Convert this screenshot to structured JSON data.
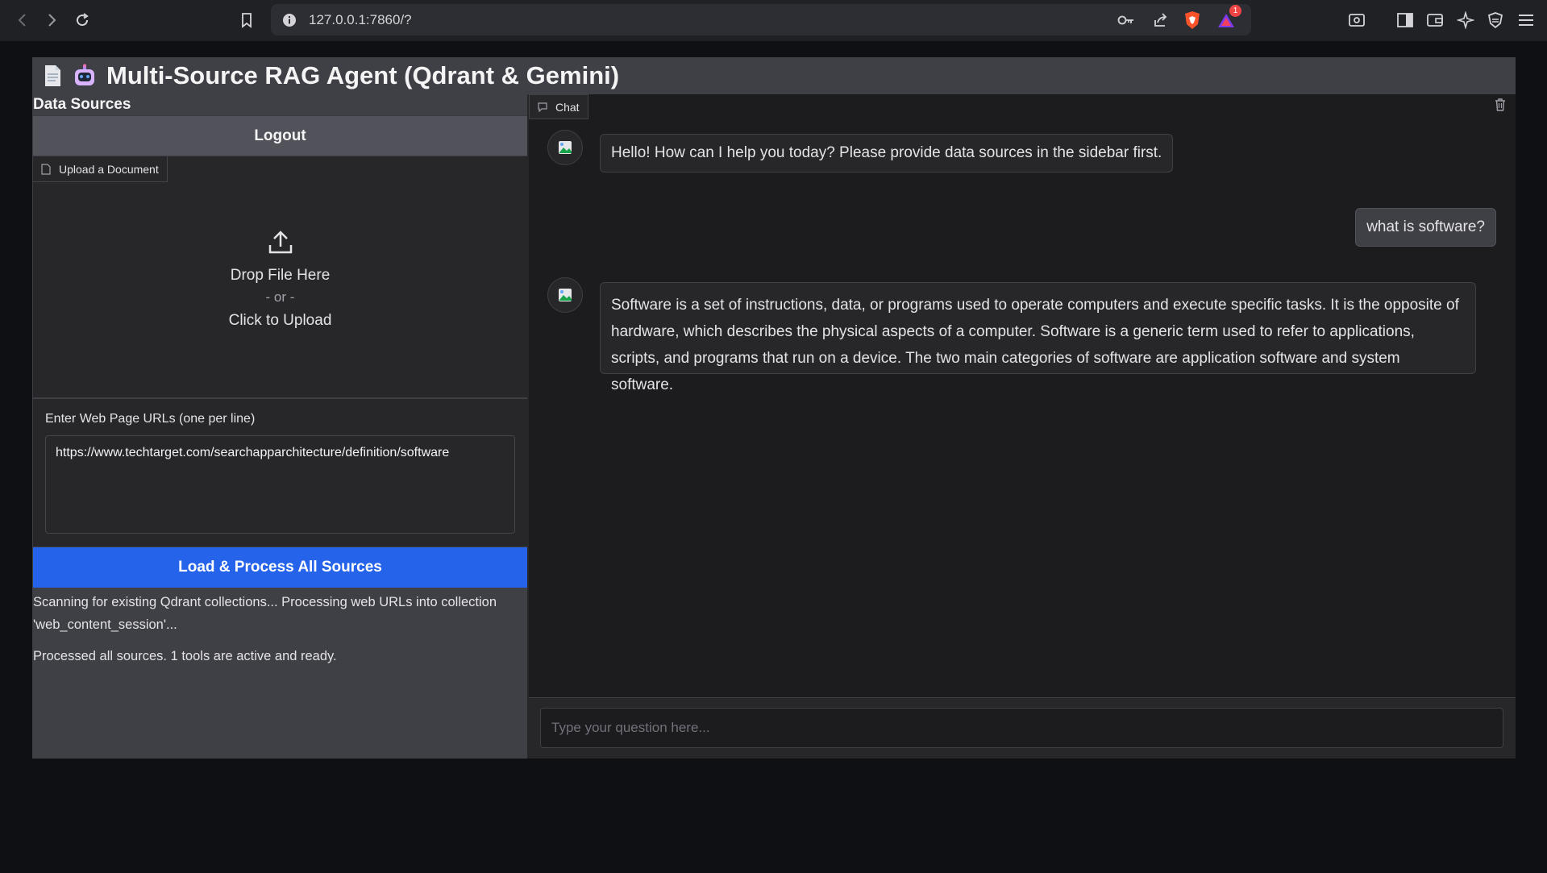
{
  "browser": {
    "url": "127.0.0.1:7860/?",
    "notification_count": "1"
  },
  "app": {
    "title": "Multi-Source RAG Agent (Qdrant & Gemini)"
  },
  "sidebar": {
    "section_label": "Data Sources",
    "logout_label": "Logout",
    "upload_tab_label": "Upload a Document",
    "drop_text": "Drop File Here",
    "or_text": "- or -",
    "click_text": "Click to Upload",
    "url_label": "Enter Web Page URLs (one per line)",
    "url_value": "https://www.techtarget.com/searchapparchitecture/definition/software",
    "process_label": "Load & Process All Sources",
    "status_line1": "Scanning for existing Qdrant collections... Processing web URLs into collection 'web_content_session'...",
    "status_line2": "Processed all sources. 1 tools are active and ready."
  },
  "chat": {
    "tab_label": "Chat",
    "messages": [
      {
        "role": "assistant",
        "text": "Hello! How can I help you today? Please provide data sources in the sidebar first."
      },
      {
        "role": "user",
        "text": "what is software?"
      },
      {
        "role": "assistant",
        "text": "Software is a set of instructions, data, or programs used to operate computers and execute specific tasks. It is the opposite of hardware, which describes the physical aspects of a computer. Software is a generic term used to refer to applications, scripts, and programs that run on a device. The two main categories of software are application software and system software."
      }
    ],
    "input_placeholder": "Type your question here..."
  },
  "colors": {
    "accent": "#2563eb",
    "panel": "#3f3f46",
    "background": "#1c1c1f"
  }
}
